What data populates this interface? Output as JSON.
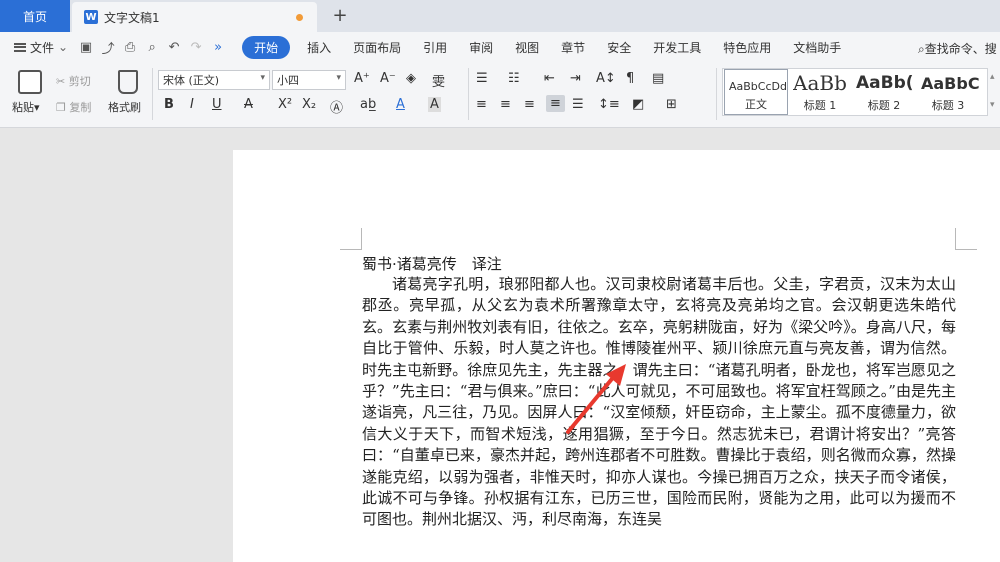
{
  "tabs": {
    "home": "首页",
    "doc": "文字文稿1",
    "doc_logo": "W",
    "add": "+"
  },
  "menu": {
    "file": "文件",
    "items": [
      "开始",
      "插入",
      "页面布局",
      "引用",
      "审阅",
      "视图",
      "章节",
      "安全",
      "开发工具",
      "特色应用",
      "文档助手"
    ],
    "search": "查找命令、搜"
  },
  "ribbon": {
    "paste": "粘贴",
    "cut": "剪切",
    "copy": "复制",
    "format_painter": "格式刷",
    "font_name": "宋体 (正文)",
    "font_size": "小四",
    "styles": [
      {
        "sample": "AaBbCcDd",
        "label": "正文"
      },
      {
        "sample": "AaBb",
        "label": "标题 1"
      },
      {
        "sample": "AaBb(",
        "label": "标题 2"
      },
      {
        "sample": "AaBbC",
        "label": "标题 3"
      }
    ]
  },
  "document": {
    "title": "蜀书·诸葛亮传　译注",
    "body": "诸葛亮字孔明，琅邪阳都人也。汉司隶校尉诸葛丰后也。父圭，字君贡，汉末为太山郡丞。亮早孤，从父玄为袁术所署豫章太守，玄将亮及亮弟均之官。会汉朝更选朱皓代玄。玄素与荆州牧刘表有旧，往依之。玄卒，亮躬耕陇亩，好为《梁父吟》。身高八尺，每自比于管仲、乐毅，时人莫之许也。惟博陵崔州平、颍川徐庶元直与亮友善，谓为信然。时先主屯新野。徐庶见先主，先主器之，谓先主曰：“诸葛孔明者，卧龙也，将军岂愿见之乎？”先主曰：“君与俱来。”庶曰：“此人可就见，不可屈致也。将军宜枉驾顾之。”由是先主遂诣亮，凡三往，乃见。因屏人曰：“汉室倾颓，奸臣窃命，主上蒙尘。孤不度德量力，欲信大义于天下，而智术短浅，遂用猖獗，至于今日。然志犹未已，君谓计将安出？”亮答曰：“自董卓已来，豪杰并起，跨州连郡者不可胜数。曹操比于袁绍，则名微而众寡，然操遂能克绍，以弱为强者，非惟天时，抑亦人谋也。今操已拥百万之众，挟天子而令诸侯，此诚不可与争锋。孙权据有江东，已历三世，国险而民附，贤能为之用，此可以为援而不可图也。荆州北据汉、沔，利尽南海，东连吴"
  },
  "colors": {
    "accent": "#2b6fd6",
    "annotation_arrow": "#e8392e"
  }
}
